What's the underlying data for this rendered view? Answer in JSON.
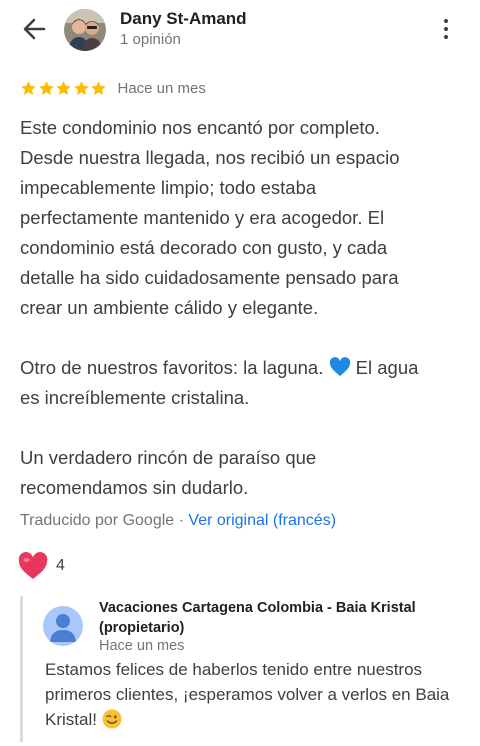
{
  "header": {
    "reviewer_name": "Dany St-Amand",
    "review_count": "1 opinión",
    "back_icon": "arrow-back-icon",
    "more_icon": "more-vert-icon"
  },
  "review": {
    "rating": 5,
    "max_rating": 5,
    "time": "Hace un mes",
    "lines": [
      "Este condominio nos encantó por completo.",
      "Desde nuestra llegada, nos recibió un espacio",
      "impecablemente limpio; todo estaba",
      "perfectamente mantenido y era acogedor. El",
      "condominio está decorado con gusto, y cada",
      "detalle ha sido cuidadosamente pensado para",
      "crear un ambiente cálido y elegante."
    ],
    "p2_line1_before": "Otro de nuestros favoritos: la laguna.",
    "p2_line1_after": "El agua",
    "p2_line2": "es increíblemente cristalina.",
    "p3_line1": "Un verdadero rincón de paraíso que",
    "p3_line2": "recomendamos sin dudarlo.",
    "translated_by": "Traducido por Google",
    "separator": "·",
    "see_original": "Ver original (francés)",
    "likes": "4"
  },
  "reply": {
    "owner_name": "Vacaciones Cartagena Colombia - Baia Kristal (propietario)",
    "time": "Hace un mes",
    "line1": "Estamos felices de haberlos tenido entre nuestros",
    "line2": "primeros clientes, ¡esperamos volver a verlos en Baia",
    "line3": "Kristal!"
  },
  "colors": {
    "star": "#fbbc04",
    "link": "#1a73e8",
    "heart": "#e8365d",
    "blue_heart": "#1e88e5",
    "owner_avatar": "#a8c7fa"
  }
}
